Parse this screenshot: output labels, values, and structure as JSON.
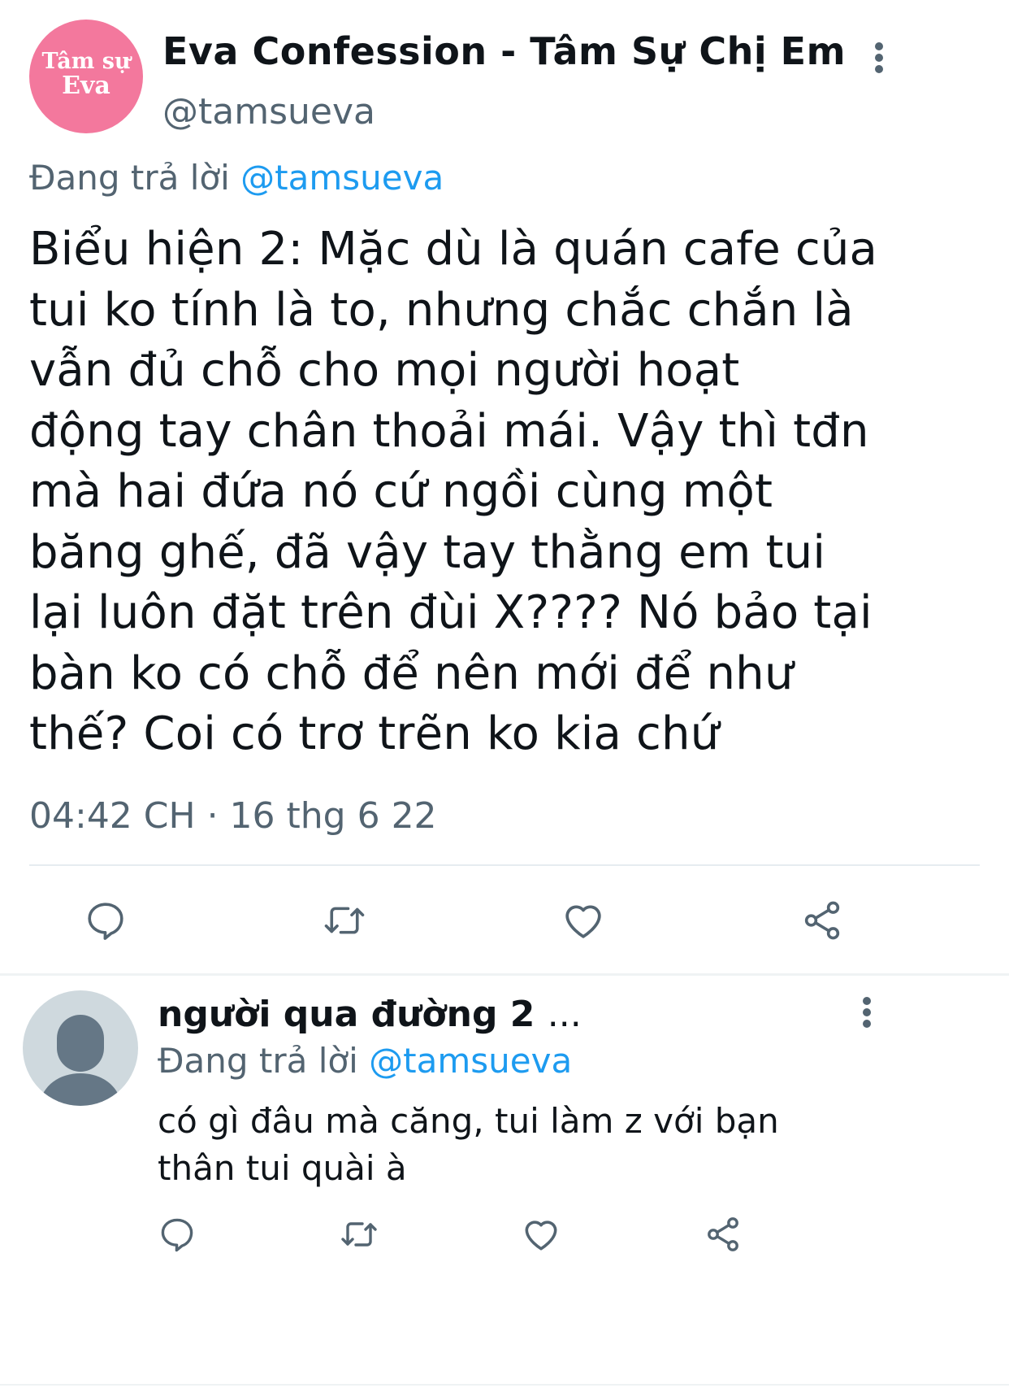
{
  "tweet": {
    "avatar_text_line1": "Tâm sự",
    "avatar_text_line2": "Eva",
    "display_name": "Eva Confession - Tâm Sự Chị Em",
    "handle": "@tamsueva",
    "replying_label": "Đang trả lời",
    "replying_to": "@tamsueva",
    "text": "Biểu hiện 2: Mặc dù là quán cafe của\ntui ko tính là to, nhưng chắc chắn là\nvẫn đủ chỗ cho mọi người hoạt\nđộng tay chân thoải mái. Vậy thì tđn\nmà hai đứa nó cứ ngồi cùng một\nbăng ghế, đã vậy tay thằng em tui\nlại luôn đặt trên đùi X???? Nó bảo tại\nbàn ko có chỗ để nên mới để như\nthế? Coi có trơ trẽn ko kia chứ",
    "timestamp": "04:42 CH · 16 thg 6 22",
    "actions": [
      "comment-icon",
      "retweet-icon",
      "like-icon",
      "share-icon"
    ]
  },
  "reply": {
    "display_name": "người qua đường 2",
    "name_truncation": "...",
    "replying_label": "Đang trả lời",
    "replying_to": "@tamsueva",
    "text": "có gì đâu mà căng, tui làm z với bạn\nthân tui quài à",
    "actions": [
      "comment-icon",
      "retweet-icon",
      "like-icon",
      "share-icon"
    ]
  },
  "colors": {
    "text": "#0f1419",
    "secondary": "#536471",
    "link": "#1d9bf0",
    "avatar_brand": "#f3789d",
    "default_avatar": "#cfd9de"
  }
}
